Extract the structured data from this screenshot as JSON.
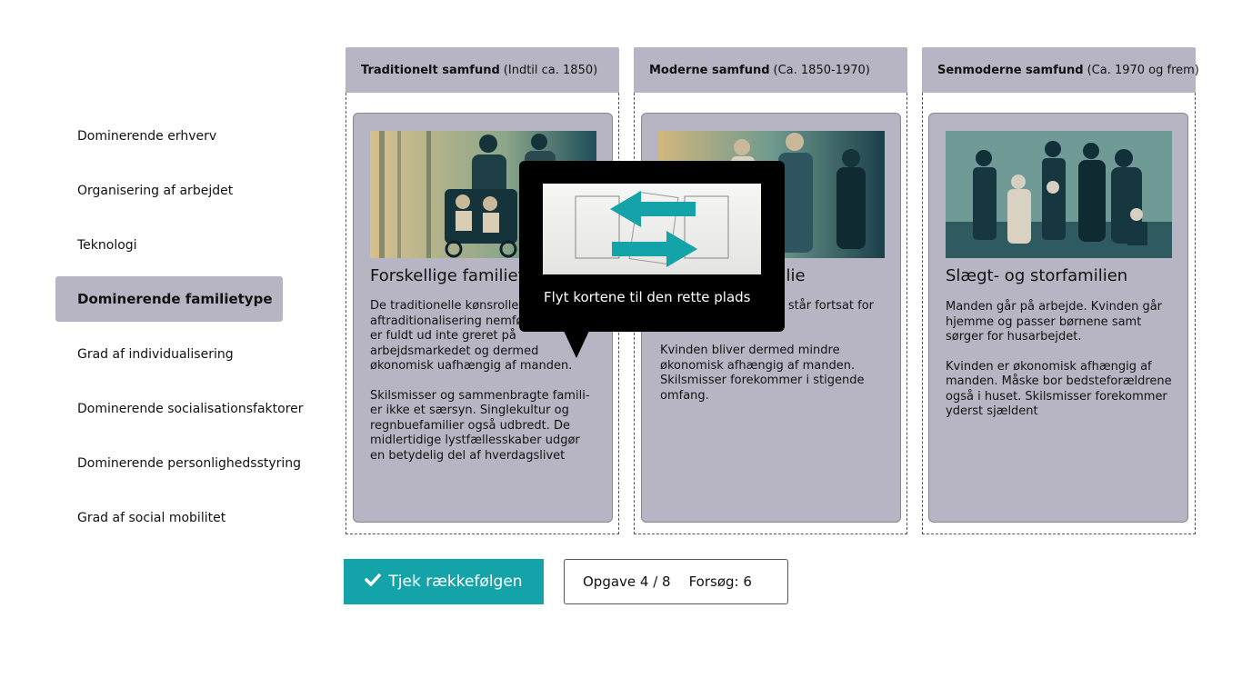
{
  "categories": [
    {
      "label": "Dominerende erhverv",
      "active": false
    },
    {
      "label": "Organisering af arbejdet",
      "active": false
    },
    {
      "label": "Teknologi",
      "active": false
    },
    {
      "label": "Dominerende familietype",
      "active": true
    },
    {
      "label": "Grad af individualisering",
      "active": false
    },
    {
      "label": "Dominerende socialisationsfaktorer",
      "active": false
    },
    {
      "label": "Dominerende personlighedsstyring",
      "active": false
    },
    {
      "label": "Grad af social mobilitet",
      "active": false
    }
  ],
  "columns": [
    {
      "title_bold": "Traditionelt samfund",
      "title_period": "(Indtil ca. 1850)"
    },
    {
      "title_bold": "Moderne samfund",
      "title_period": "(Ca. 1850-1970)"
    },
    {
      "title_bold": "Senmoderne samfund",
      "title_period": "(Ca. 1970 og frem)"
    }
  ],
  "cards": [
    {
      "title": "Forskellige familiety",
      "paragraphs": [
        "De traditionelle kønsroller der da aftraditionalisering nemført. Kvinden er fuldt ud inte greret på arbejdsmarkedet og dermed økonomisk uafhængig af manden.",
        "Skilsmisser og sammenbragte famili­er ikke et særsyn. Singlekultur og regnbuefamilier også udbredt. De midlertidige lystfællesskaber udgør en betydelig del af hverdagslivet"
      ]
    },
    {
      "title": "milie",
      "paragraphs": [
        "komme på n kvinden står fortsat for husarbejdet.",
        "Kvinden bliver dermed mindre økonomisk afhængig af manden. Skilsmisser forekom­mer i stigende omfang."
      ]
    },
    {
      "title": "Slægt- og storfamilien",
      "paragraphs": [
        "Manden går på arbejde. Kvinden går hjemme og passer børnene samt sørger for husarbejdet.",
        "Kvinden er økonomisk afhængig af manden. Måske bor bedste­forældrene også i huset. Skils­misser forekommer yderst sjældent"
      ]
    }
  ],
  "tooltip": {
    "text": "Flyt kortene til den rette plads"
  },
  "controls": {
    "check_label": "Tjek rækkefølgen",
    "task_text": "Opgave 4 / 8",
    "attempts_text": "Forsøg: 6"
  },
  "colors": {
    "accent": "#14a3a8",
    "card": "#b7b5c3"
  }
}
